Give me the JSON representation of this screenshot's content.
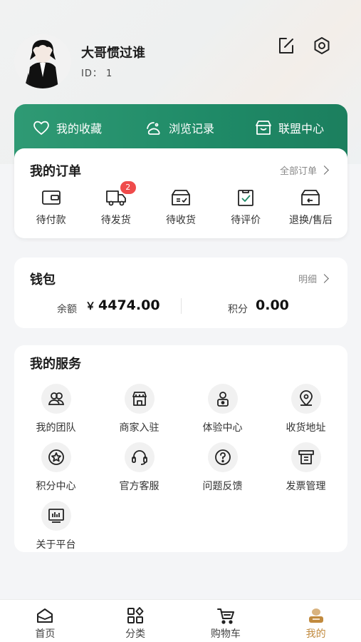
{
  "profile": {
    "username": "大哥惯过谁",
    "id_text": "ID： 1",
    "icons": [
      "edit-icon",
      "gear-icon"
    ]
  },
  "quick_links": [
    {
      "label": "我的收藏",
      "icon": "heart-icon"
    },
    {
      "label": "浏览记录",
      "icon": "footprints-icon"
    },
    {
      "label": "联盟中心",
      "icon": "store-icon"
    }
  ],
  "orders": {
    "title": "我的订单",
    "all_link": "全部订单",
    "items": [
      {
        "label": "待付款",
        "icon": "wallet-icon",
        "badge": ""
      },
      {
        "label": "待发货",
        "icon": "truck-icon",
        "badge": "2"
      },
      {
        "label": "待收货",
        "icon": "box-icon",
        "badge": ""
      },
      {
        "label": "待评价",
        "icon": "clipboard-check-icon",
        "badge": ""
      },
      {
        "label": "退换/售后",
        "icon": "return-box-icon",
        "badge": ""
      }
    ]
  },
  "wallet": {
    "title": "钱包",
    "detail_link": "明细",
    "balance_label": "余额",
    "currency": "￥",
    "balance_value": "4474.00",
    "points_label": "积分",
    "points_value": "0.00"
  },
  "services": {
    "title": "我的服务",
    "items": [
      {
        "label": "我的团队",
        "icon": "team-icon"
      },
      {
        "label": "商家入驻",
        "icon": "shop-icon"
      },
      {
        "label": "体验中心",
        "icon": "person-badge-icon"
      },
      {
        "label": "收货地址",
        "icon": "location-icon"
      },
      {
        "label": "积分中心",
        "icon": "star-medal-icon"
      },
      {
        "label": "官方客服",
        "icon": "headset-icon"
      },
      {
        "label": "问题反馈",
        "icon": "question-icon"
      },
      {
        "label": "发票管理",
        "icon": "invoice-icon"
      },
      {
        "label": "关于平台",
        "icon": "monitor-chart-icon"
      }
    ]
  },
  "tabbar": {
    "items": [
      {
        "label": "首页",
        "icon": "home-icon",
        "active": false
      },
      {
        "label": "分类",
        "icon": "category-icon",
        "active": false
      },
      {
        "label": "购物车",
        "icon": "cart-icon",
        "active": false
      },
      {
        "label": "我的",
        "icon": "profile-icon",
        "active": true
      }
    ],
    "active_color": "#c18a3e"
  },
  "colors": {
    "brand_green": "#1f8a67",
    "badge_red": "#ef4b4b"
  }
}
